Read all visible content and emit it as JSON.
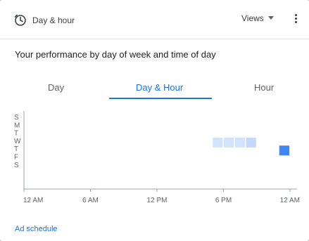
{
  "header": {
    "title": "Day & hour",
    "icon": "clock-icon",
    "views_label": "Views",
    "more_icon": "more-vert-icon"
  },
  "subtitle": "Your performance by day of week and time of day",
  "tabs": [
    {
      "label": "Day",
      "active": false
    },
    {
      "label": "Day & Hour",
      "active": true
    },
    {
      "label": "Hour",
      "active": false
    }
  ],
  "chart_data": {
    "type": "heatmap",
    "y_categories": [
      "S",
      "M",
      "T",
      "W",
      "T",
      "F",
      "S"
    ],
    "x_tick_labels": [
      "12 AM",
      "6 AM",
      "12 PM",
      "6 PM",
      "12 AM"
    ],
    "x_range_hours": [
      0,
      24
    ],
    "cells": [
      {
        "day_index": 3,
        "hour": 17,
        "intensity": 0.12
      },
      {
        "day_index": 3,
        "hour": 18,
        "intensity": 0.12
      },
      {
        "day_index": 3,
        "hour": 19,
        "intensity": 0.12
      },
      {
        "day_index": 3,
        "hour": 20,
        "intensity": 0.22
      },
      {
        "day_index": 4,
        "hour": 23,
        "intensity": 1.0
      }
    ],
    "colors": {
      "low": "#e8f0fe",
      "high": "#4285f4"
    }
  },
  "footer": {
    "link_label": "Ad schedule"
  }
}
